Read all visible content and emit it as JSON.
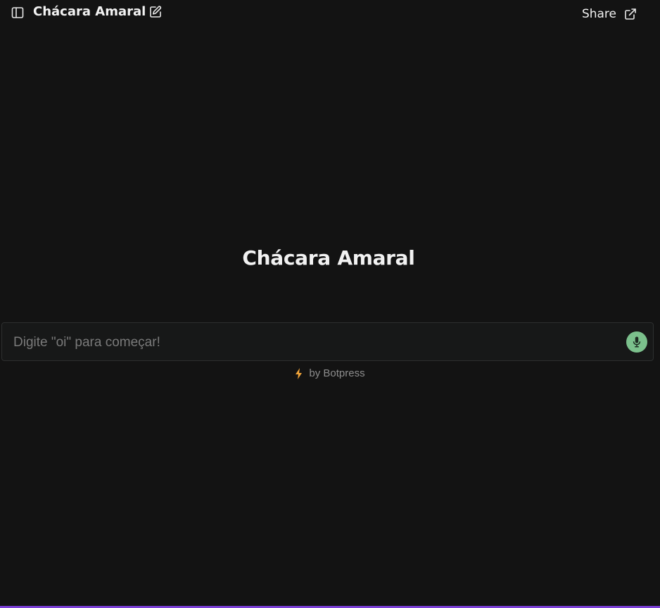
{
  "header": {
    "title": "Chácara Amaral",
    "share_label": "Share"
  },
  "main": {
    "title": "Chácara Amaral"
  },
  "composer": {
    "placeholder": "Digite \"oi\" para começar!",
    "value": ""
  },
  "footer": {
    "powered_by": "by Botpress"
  },
  "icons": {
    "sidebar": "sidebar-panel-icon",
    "edit": "edit-pencil-icon",
    "share": "external-link-icon",
    "mic": "microphone-icon",
    "bolt": "lightning-bolt-icon"
  },
  "colors": {
    "background": "#131313",
    "composer_background": "#171818",
    "mic_accent": "#7bc08c",
    "bolt_accent": "#f0a43a",
    "bottom_accent": "#7b3fd6"
  }
}
